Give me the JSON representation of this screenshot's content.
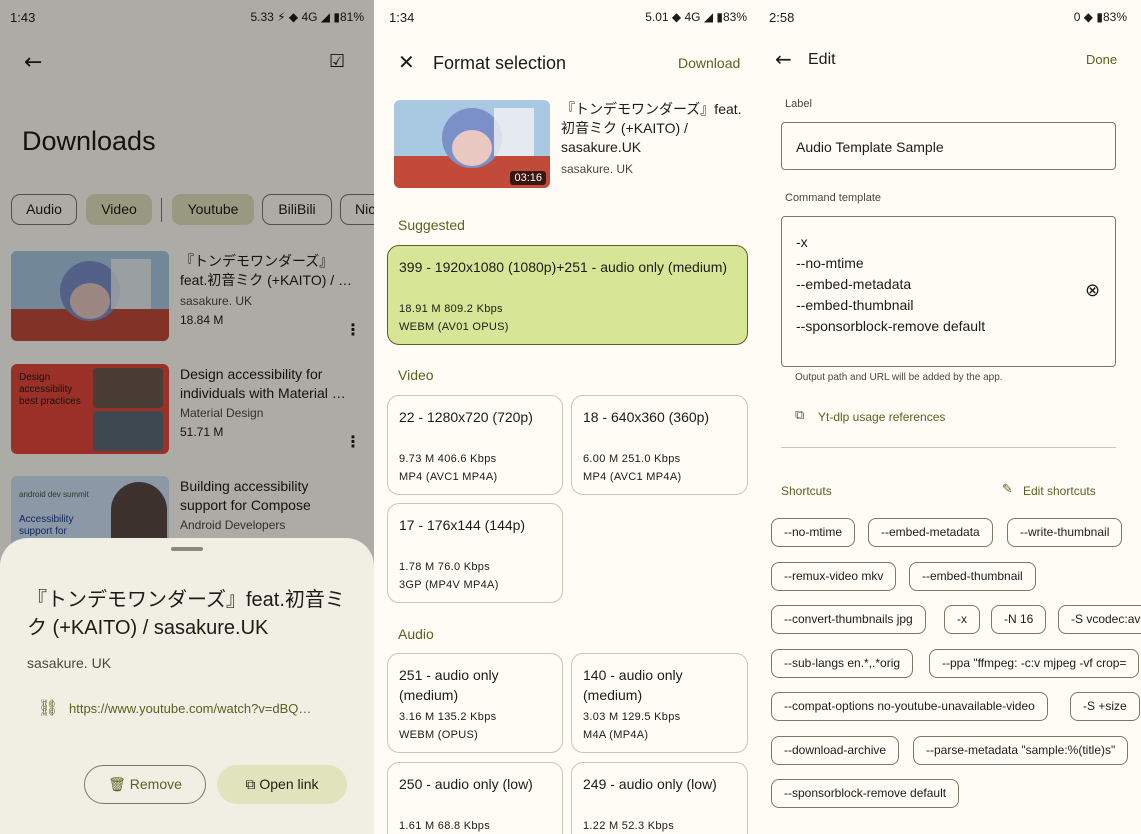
{
  "downloads": {
    "status": {
      "time": "1:43",
      "stat": "5.33 ⚡ ◆ 4G ◢ ▮81%"
    },
    "title": "Downloads",
    "chips": [
      "Audio",
      "Video",
      "Youtube",
      "BiliBili",
      "Nic"
    ],
    "items": [
      {
        "title": "『トンデモワンダーズ』feat.初音ミク (+KAITO)  / …",
        "channel": "sasakure. UK",
        "size": "18.84 M"
      },
      {
        "title": "Design accessibility for individuals with Material …",
        "channel": "Material Design",
        "size": "51.71 M"
      },
      {
        "title": "Building accessibility support for Compose",
        "channel": "Android Developers",
        "size": ""
      }
    ],
    "thumb_text": {
      "design": "Design accessibility best practices",
      "compose_brand": "android dev summit",
      "compose": "Accessibility support for Compose"
    },
    "sheet": {
      "title": "『トンデモワンダーズ』feat.初音ミク (+KAITO)  / sasakure.UK",
      "channel": "sasakure. UK",
      "url": "https://www.youtube.com/watch?v=dBQ…",
      "remove_label": "Remove",
      "open_label": "Open link"
    }
  },
  "format": {
    "status": {
      "time": "1:34",
      "stat": "5.01 ◆ 4G ◢ ▮83%"
    },
    "title": "Format selection",
    "download_label": "Download",
    "video": {
      "title": "『トンデモワンダーズ』feat.初音ミク (+KAITO)  /  sasakure.UK",
      "channel": "sasakure. UK",
      "duration": "03:16"
    },
    "suggested_header": "Suggested",
    "suggested": {
      "title": "399 - 1920x1080 (1080p)+251 - audio only (medium)",
      "size": "18.91 M 809.2 Kbps",
      "codec": "WEBM (AV01 OPUS)"
    },
    "video_header": "Video",
    "video_formats": [
      {
        "title": "22 - 1280x720 (720p)",
        "size": "9.73 M 406.6 Kbps",
        "codec": "MP4 (AVC1 MP4A)"
      },
      {
        "title": "18 - 640x360 (360p)",
        "size": "6.00 M 251.0 Kbps",
        "codec": "MP4 (AVC1 MP4A)"
      },
      {
        "title": "17 - 176x144 (144p)",
        "size": "1.78 M 76.0 Kbps",
        "codec": "3GP (MP4V MP4A)"
      }
    ],
    "audio_header": "Audio",
    "audio_formats": [
      {
        "title": "251 - audio only (medium)",
        "size": "3.16 M 135.2 Kbps",
        "codec": "WEBM (OPUS)"
      },
      {
        "title": "140 - audio only (medium)",
        "size": "3.03 M 129.5 Kbps",
        "codec": "M4A (MP4A)"
      },
      {
        "title": "250 - audio only (low)",
        "size": "1.61 M 68.8 Kbps",
        "codec": ""
      },
      {
        "title": "249 - audio only (low)",
        "size": "1.22 M 52.3 Kbps",
        "codec": ""
      }
    ]
  },
  "edit": {
    "status": {
      "time": "2:58",
      "stat": "0 ◆ ▮83%"
    },
    "title": "Edit",
    "done_label": "Done",
    "label_caption": "Label",
    "label_value": "Audio Template Sample",
    "command_caption": "Command template",
    "command_lines": [
      "-x",
      "--no-mtime",
      "--embed-metadata",
      "--embed-thumbnail",
      "--sponsorblock-remove default"
    ],
    "helper": "Output path and URL will be added by the app.",
    "usage_link": "Yt-dlp usage references",
    "shortcuts_header": "Shortcuts",
    "edit_shortcuts": "Edit shortcuts",
    "shortcuts": [
      "--no-mtime",
      "--embed-metadata",
      "--write-thumbnail",
      "--remux-video mkv",
      "--embed-thumbnail",
      "--convert-thumbnails jpg",
      "-x",
      "-N 16",
      "-S vcodec:av",
      "--sub-langs en.*,.*orig",
      "--ppa \"ffmpeg: -c:v mjpeg -vf crop=",
      "--compat-options no-youtube-unavailable-video",
      "-S +size",
      "--download-archive",
      "--parse-metadata \"sample:%(title)s\"",
      "--sponsorblock-remove default"
    ]
  }
}
